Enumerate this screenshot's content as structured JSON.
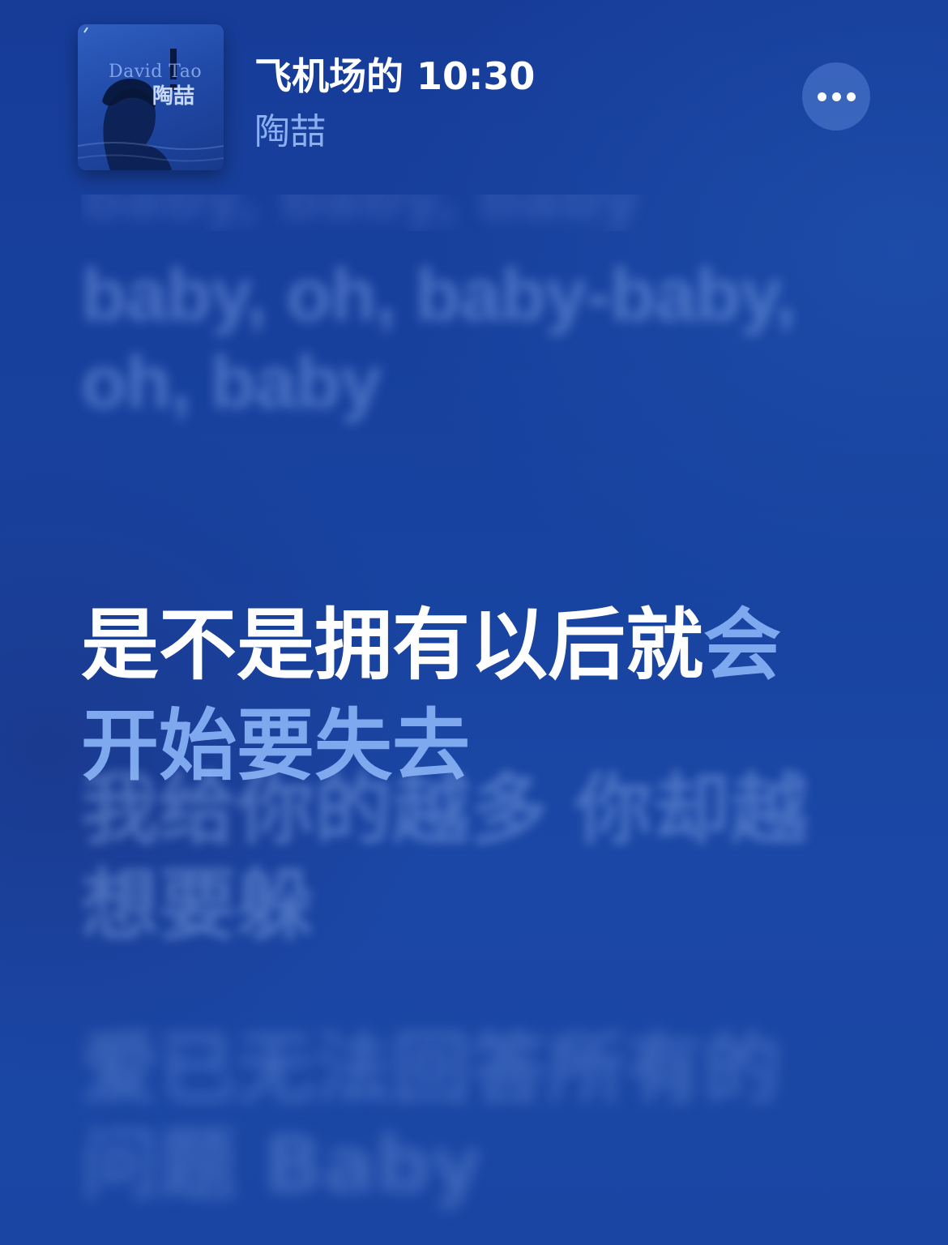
{
  "now_playing": {
    "title": "飞机场的 10:30",
    "artist": "陶喆",
    "artwork": {
      "text_en": "David Tao",
      "text_zh": "陶喆"
    },
    "more_icon": "ellipsis-icon"
  },
  "lyrics": {
    "faded_top": "baby, baby, baby",
    "previous": "baby, oh, baby-baby,\noh, baby",
    "current_sung": "是不是拥有以后就",
    "current_unsung_1": "会",
    "current_unsung_2": "开始要失去",
    "next_1": "我给你的越多 你却越\n想要躲",
    "next_2": "爱已无法回答所有的\n问题 Baby"
  },
  "colors": {
    "background": "#1843a0",
    "sung_text": "#ffffff",
    "unsung_text": "#7fa9ee",
    "artist_text": "#a0c3ff"
  }
}
